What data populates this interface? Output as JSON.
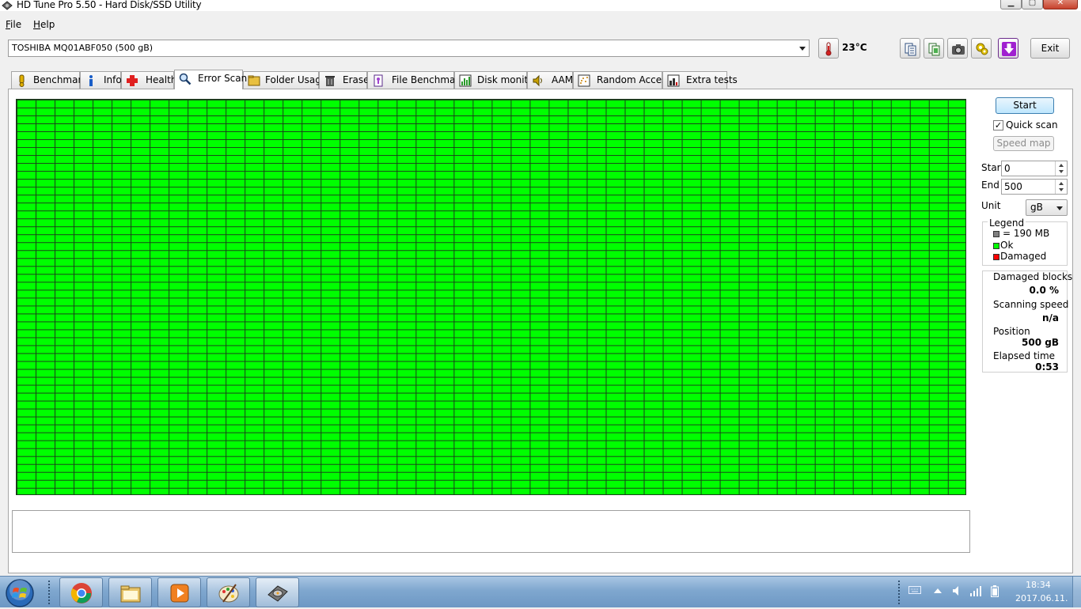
{
  "window": {
    "title": "HD Tune Pro 5.50 - Hard Disk/SSD Utility",
    "minimize": "▁",
    "maximize": "▢",
    "close": "✕"
  },
  "menu": [
    {
      "label": "File"
    },
    {
      "label": "Help"
    }
  ],
  "toolbar": {
    "drive": "TOSHIBA MQ01ABF050 (500 gB)",
    "temperature": "23°C",
    "exit_label": "Exit",
    "icons": [
      "thermometer-icon",
      "copy-text-icon",
      "copy-info-icon",
      "screenshot-icon",
      "options-icon",
      "save-icon"
    ]
  },
  "tabs": [
    {
      "label": "Benchmark",
      "icon": "benchmark-icon"
    },
    {
      "label": "Info",
      "icon": "info-icon"
    },
    {
      "label": "Health",
      "icon": "health-icon"
    },
    {
      "label": "Error Scan",
      "icon": "search-icon",
      "active": true
    },
    {
      "label": "Folder Usage",
      "icon": "folder-icon"
    },
    {
      "label": "Erase",
      "icon": "trash-icon"
    },
    {
      "label": "File Benchmark",
      "icon": "file-benchmark-icon"
    },
    {
      "label": "Disk monitor",
      "icon": "disk-monitor-icon"
    },
    {
      "label": "AAM",
      "icon": "speaker-icon"
    },
    {
      "label": "Random Access",
      "icon": "random-access-icon"
    },
    {
      "label": "Extra tests",
      "icon": "extra-tests-icon"
    }
  ],
  "scan": {
    "start_label": "Start",
    "quick_scan_label": "Quick scan",
    "quick_scan_checked": true,
    "quick_scan_mark": "✓",
    "speed_map_label": "Speed map",
    "start_field_label": "Start",
    "start_value": "0",
    "end_field_label": "End",
    "end_value": "500",
    "unit_label": "Unit",
    "unit_value": "gB",
    "grid_status": "Ok",
    "grid_color": "#00ff00",
    "damaged_fraction": 0.0
  },
  "legend": {
    "title": "Legend",
    "items": [
      {
        "label": "= 190 MB",
        "color": "#808080"
      },
      {
        "label": "Ok",
        "color": "#00ff00"
      },
      {
        "label": "Damaged",
        "color": "#ff0000"
      }
    ]
  },
  "stats": {
    "damaged_blocks_label": "Damaged blocks",
    "damaged_blocks_value": "0.0 %",
    "scanning_speed_label": "Scanning speed",
    "scanning_speed_value": "n/a",
    "position_label": "Position",
    "position_value": "500 gB",
    "elapsed_time_label": "Elapsed time",
    "elapsed_time_value": "0:53"
  },
  "taskbar": {
    "apps": [
      "chrome-icon",
      "explorer-icon",
      "media-player-icon",
      "paint-icon",
      "hd-tune-icon"
    ],
    "time": "18:34",
    "date": "2017.06.11."
  }
}
